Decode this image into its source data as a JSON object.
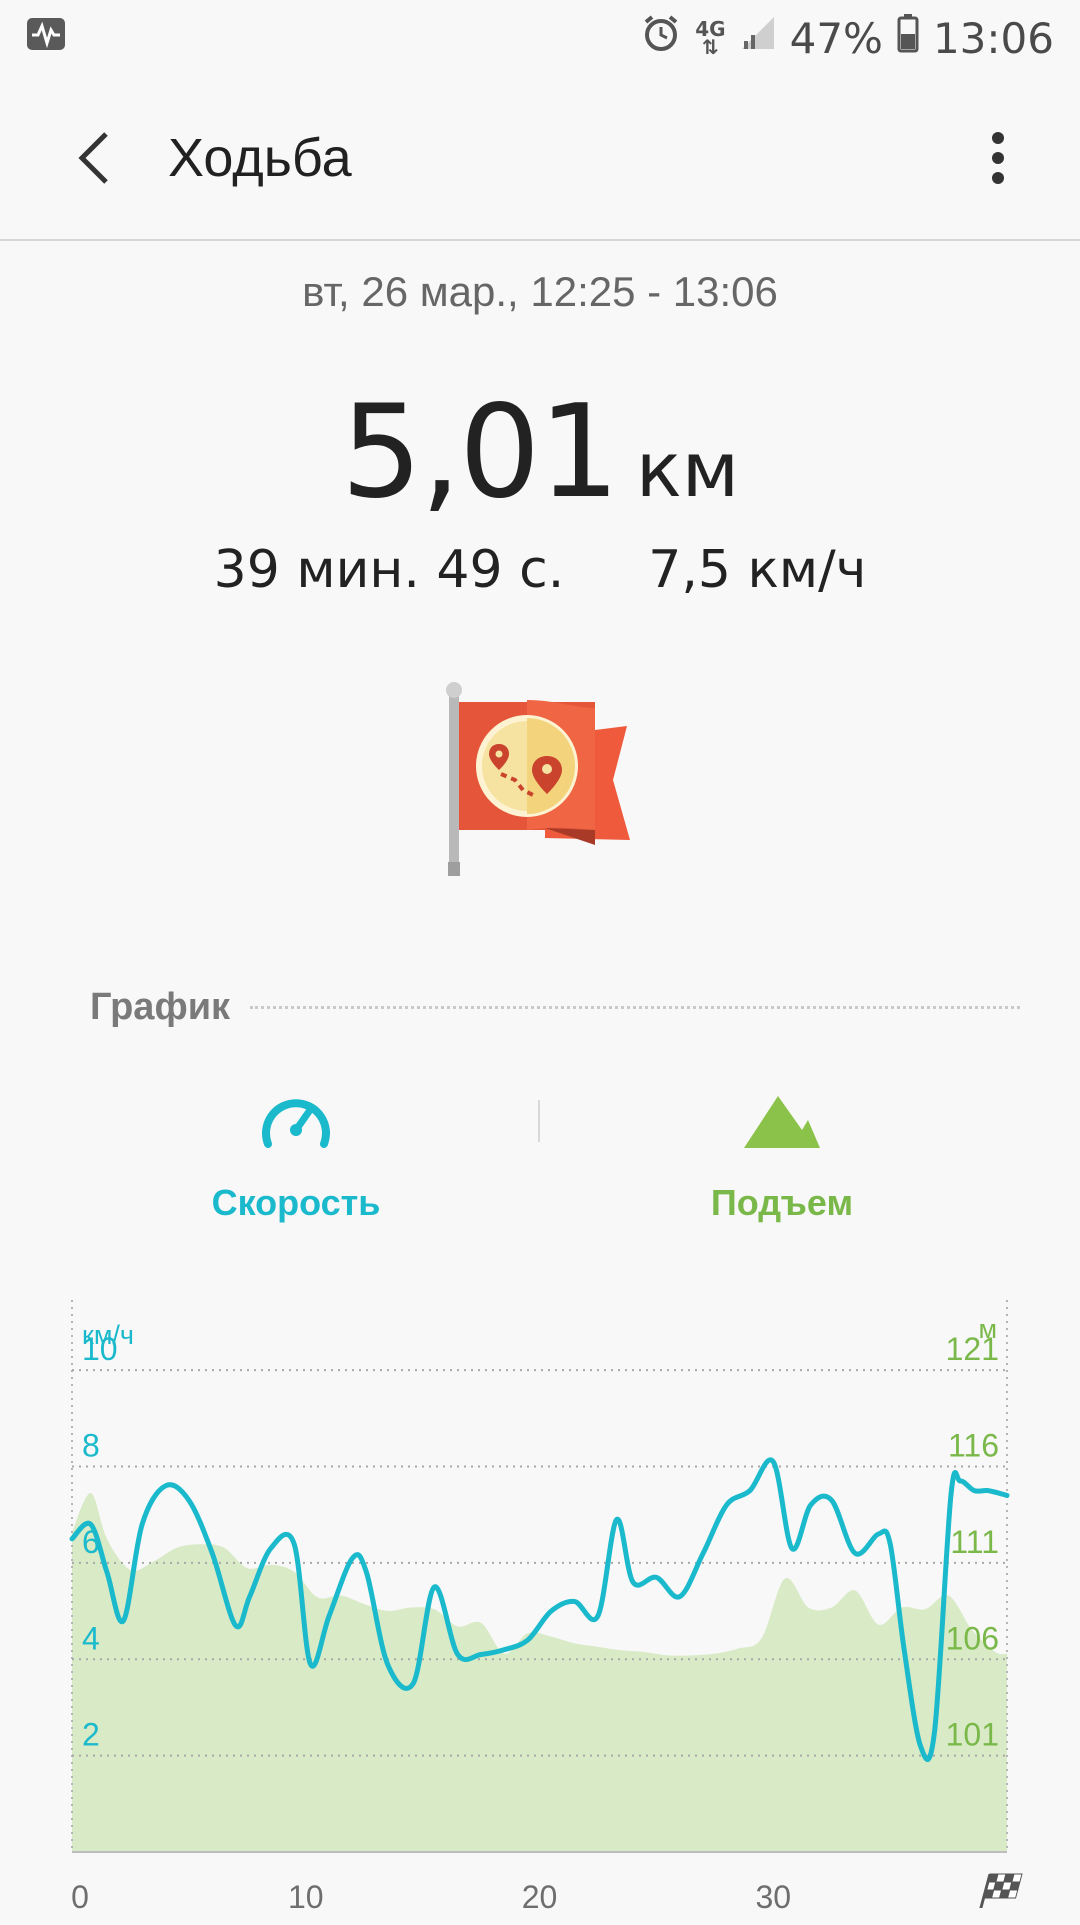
{
  "status_bar": {
    "battery": "47%",
    "time": "13:06",
    "network": "4G",
    "icons": [
      "activity-icon",
      "alarm-icon",
      "network-4g-icon",
      "signal-icon",
      "battery-icon"
    ]
  },
  "header": {
    "title": "Ходьба",
    "back_icon": "back-arrow-icon",
    "menu_icon": "more-vert-icon"
  },
  "workout": {
    "date_range": "вт, 26 мар., 12:25 - 13:06",
    "distance_value": "5,01",
    "distance_unit": "км",
    "duration": "39 мин. 49 с.",
    "avg_speed": "7,5 км/ч",
    "badge_icon": "route-flag-badge-icon"
  },
  "chart_section": {
    "label": "График"
  },
  "tabs": [
    {
      "label": "Скорость",
      "icon": "speedometer-icon",
      "color": "#1ab9cb"
    },
    {
      "label": "Подъем",
      "icon": "mountain-icon",
      "color": "#7bb84a"
    }
  ],
  "chart_data": {
    "type": "line",
    "left_axis": {
      "label": "км/ч",
      "ticks": [
        "10",
        "8",
        "6",
        "4",
        "2"
      ],
      "ylim": [
        0,
        11
      ],
      "color": "#1ab9cb"
    },
    "right_axis": {
      "label": "м",
      "ticks": [
        "121",
        "116",
        "111",
        "106",
        "101"
      ],
      "ylim": [
        94,
        125
      ],
      "color": "#7bb84a"
    },
    "x_axis": {
      "ticks": [
        "0",
        "10",
        "20",
        "30"
      ],
      "xlim": [
        0,
        40
      ],
      "finish_icon": "checkered-flag-icon"
    },
    "grid": true,
    "series": [
      {
        "axis": "left",
        "style": "line",
        "color": "#1ab9cb",
        "x": [
          0,
          0.8,
          1.5,
          2.2,
          3,
          4,
          5,
          6,
          7,
          7.6,
          8.5,
          9.5,
          10.2,
          11,
          12,
          12.6,
          13.5,
          14.6,
          15.5,
          16.5,
          17.5,
          18.5,
          19.5,
          20.5,
          21.5,
          22.5,
          23.3,
          24,
          25,
          26,
          27,
          28,
          29,
          30,
          30.8,
          31.6,
          32.5,
          33.5,
          34.5,
          35,
          35.6,
          36.3,
          36.9,
          37.6,
          38,
          38.6,
          39.2,
          40
        ],
        "y": [
          6.5,
          6.8,
          5.8,
          4.8,
          6.8,
          7.6,
          7.3,
          6.2,
          4.7,
          5.3,
          6.3,
          6.4,
          3.9,
          4.9,
          6.1,
          5.8,
          3.9,
          3.5,
          5.5,
          4.1,
          4.1,
          4.2,
          4.4,
          5.0,
          5.2,
          4.9,
          6.9,
          5.6,
          5.7,
          5.3,
          6.2,
          7.2,
          7.5,
          8.1,
          6.3,
          7.2,
          7.3,
          6.2,
          6.6,
          6.4,
          4.2,
          2.2,
          2.5,
          7.4,
          7.7,
          7.5,
          7.5,
          7.4
        ]
      },
      {
        "axis": "right",
        "style": "area",
        "color": "#d9eac7",
        "x": [
          0,
          0.8,
          1.5,
          2.5,
          3.5,
          4.5,
          5.5,
          6.5,
          7.5,
          8.5,
          9.5,
          10.5,
          11.5,
          12.5,
          13.5,
          14.5,
          15.5,
          16.5,
          17.5,
          18.5,
          19.5,
          20.5,
          21.5,
          22.5,
          23.5,
          24.5,
          25.5,
          26.5,
          27.5,
          28.5,
          29.5,
          30.5,
          31.5,
          32.5,
          33.5,
          34.5,
          35.5,
          36.5,
          37.5,
          38.5,
          39.5,
          40
        ],
        "y": [
          112.7,
          115.0,
          112.3,
          110.5,
          111.0,
          111.8,
          112.0,
          111.8,
          110.6,
          110.8,
          110.4,
          108.9,
          109.0,
          108.5,
          108.1,
          108.3,
          108.2,
          107.2,
          107.4,
          105.6,
          106.8,
          106.6,
          106.2,
          106.0,
          105.8,
          105.7,
          105.5,
          105.5,
          105.6,
          105.9,
          106.5,
          110.0,
          108.3,
          108.3,
          109.3,
          107.3,
          108.3,
          108.2,
          109.0,
          107.0,
          105.7,
          105.6
        ]
      }
    ]
  }
}
